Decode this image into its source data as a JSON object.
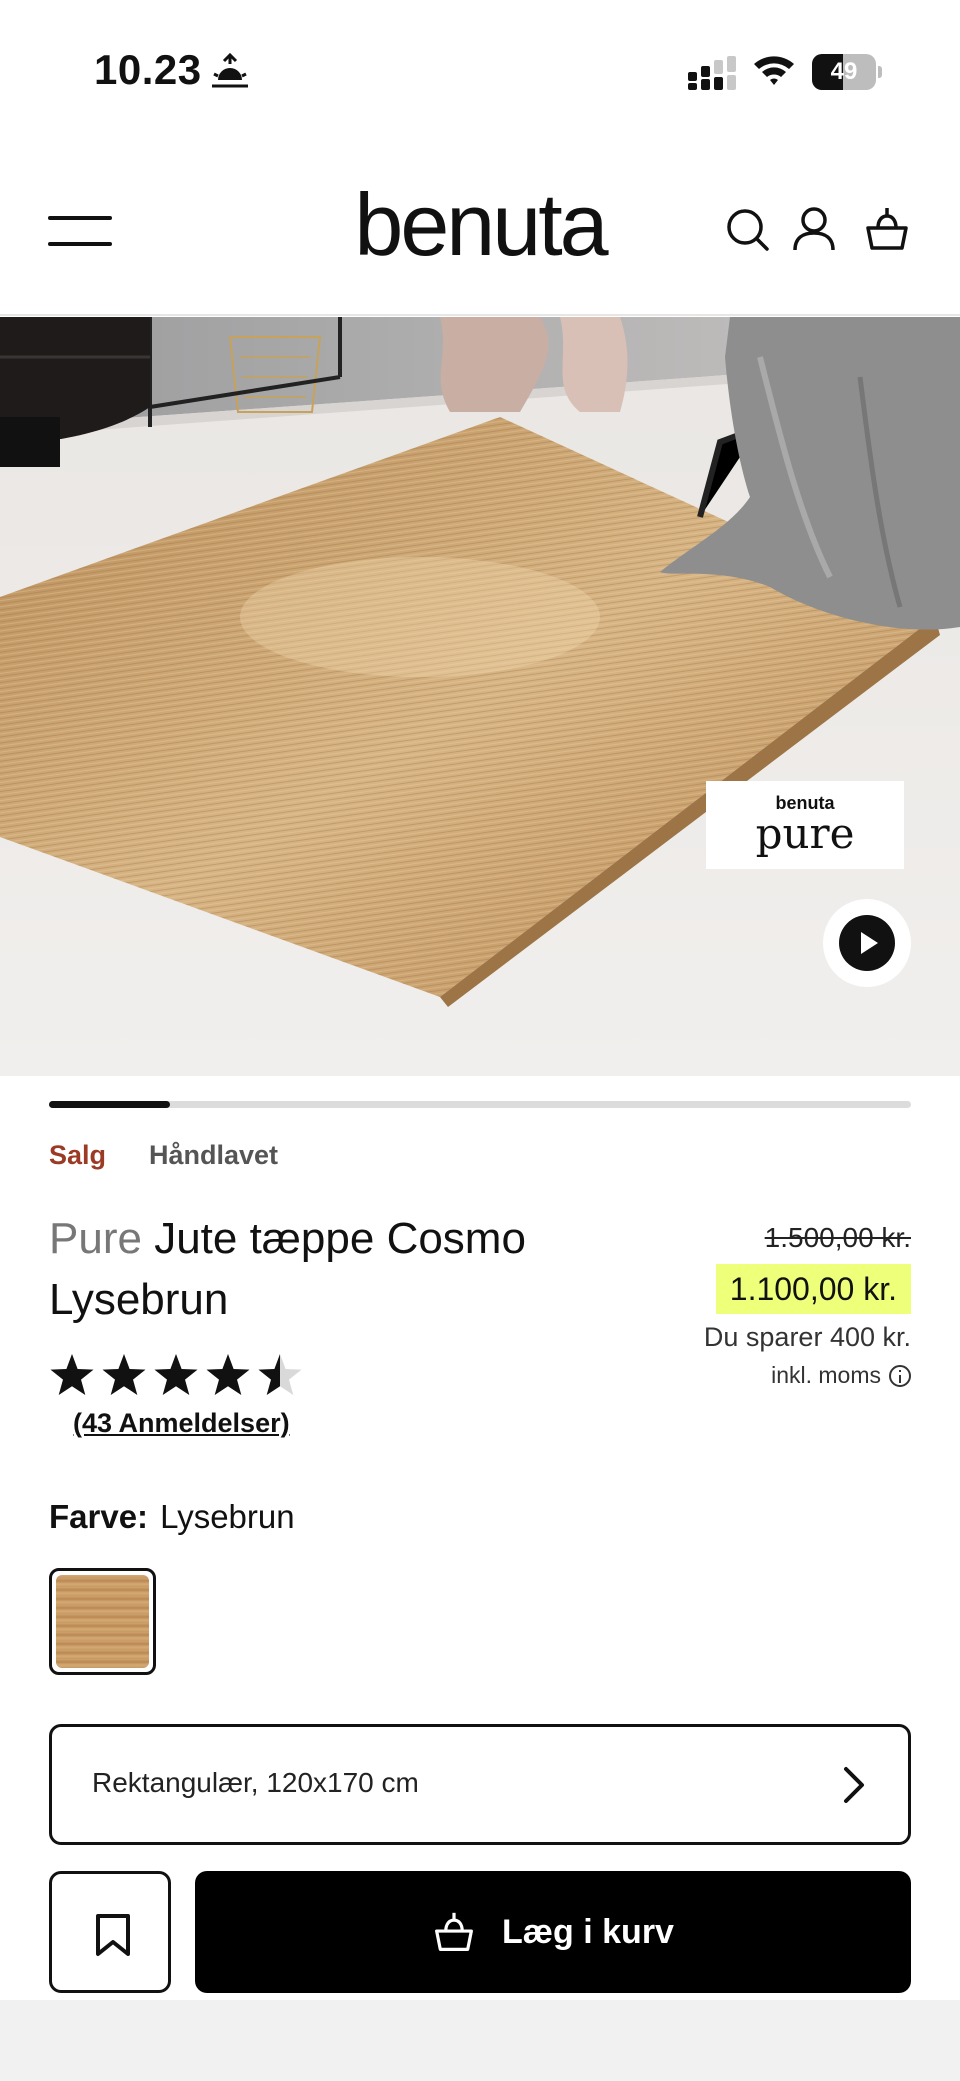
{
  "status_bar": {
    "time": "10.23",
    "battery": "49",
    "battery_level": 0.49
  },
  "header": {
    "logo": "benuta",
    "icons": [
      "menu-icon",
      "search-icon",
      "account-icon",
      "basket-icon"
    ]
  },
  "hero": {
    "badge_brand": "benuta",
    "badge_line": "pure",
    "carousel_progress": 0.14
  },
  "tags": {
    "sale": "Salg",
    "handmade": "Håndlavet"
  },
  "product": {
    "brand": "Pure",
    "name": "Jute tæppe Cosmo Lysebrun",
    "rating": 4.5,
    "rating_max": 5,
    "reviews": "(43 Anmeldelser)"
  },
  "price": {
    "old": "1.500,00 kr.",
    "new": "1.100,00 kr.",
    "saving": "Du sparer 400 kr.",
    "vat": "inkl. moms"
  },
  "color": {
    "label": "Farve:",
    "value": "Lysebrun"
  },
  "size": {
    "value": "Rektangulær, 120x170 cm"
  },
  "actions": {
    "add_to_cart": "Læg i kurv"
  },
  "colors": {
    "sale": "#9b3b25",
    "price_highlight": "#eeff7a",
    "primary": "#000000"
  }
}
